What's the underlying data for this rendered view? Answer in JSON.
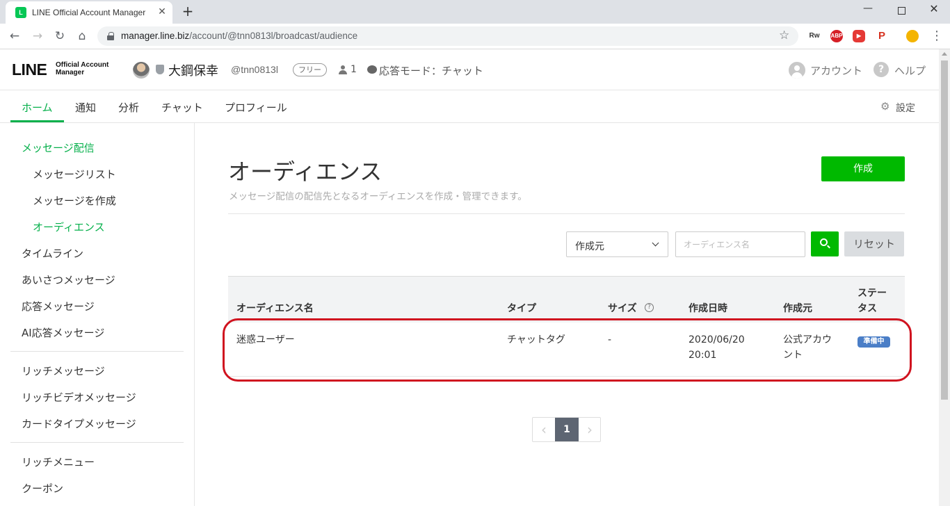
{
  "browser": {
    "tab_title": "LINE Official Account Manager",
    "favicon_letter": "L",
    "url_host": "manager.line.biz",
    "url_path": "/account/@tnn0813l/broadcast/audience",
    "nav_back": "←",
    "nav_forward": "→",
    "nav_reload": "↻",
    "nav_home": "⌂",
    "new_tab": "+",
    "close_tab": "✕",
    "win_min": "—",
    "win_close": "✕",
    "star": "☆",
    "menu": "⋮",
    "extensions": [
      {
        "name": "rw",
        "label": "Rw",
        "color": "#ffffff"
      },
      {
        "name": "abp",
        "label": "ABP",
        "color": "#d61f26"
      },
      {
        "name": "youtube",
        "label": "▶",
        "color": "#e53935"
      },
      {
        "name": "pocket",
        "label": "P",
        "color": "#d6311f"
      },
      {
        "name": "keep",
        "label": "",
        "color": "#f4b400"
      }
    ]
  },
  "header": {
    "logo_main": "LINE",
    "logo_sub1": "Official Account",
    "logo_sub2": "Manager",
    "account_name": "大鋼保幸",
    "account_id": "@tnn0813l",
    "plan": "フリー",
    "friends_count": "1",
    "reply_mode": "応答モード：チャット",
    "account_link": "アカウント",
    "help_icon": "?",
    "help_link": "ヘルプ"
  },
  "nav": {
    "tabs": [
      {
        "label": "ホーム",
        "active": true
      },
      {
        "label": "通知",
        "active": false
      },
      {
        "label": "分析",
        "active": false
      },
      {
        "label": "チャット",
        "active": false
      },
      {
        "label": "プロフィール",
        "active": false
      }
    ],
    "gear": "⚙",
    "settings": "設定"
  },
  "sidebar": {
    "items": [
      {
        "label": "メッセージ配信",
        "level": 0,
        "active": true
      },
      {
        "label": "メッセージリスト",
        "level": 1,
        "active": false
      },
      {
        "label": "メッセージを作成",
        "level": 1,
        "active": false
      },
      {
        "label": "オーディエンス",
        "level": 1,
        "active": true
      },
      {
        "label": "タイムライン",
        "level": 0,
        "active": false
      },
      {
        "label": "あいさつメッセージ",
        "level": 0,
        "active": false
      },
      {
        "label": "応答メッセージ",
        "level": 0,
        "active": false
      },
      {
        "label": "AI応答メッセージ",
        "level": 0,
        "active": false
      },
      {
        "label": "リッチメッセージ",
        "level": 0,
        "active": false
      },
      {
        "label": "リッチビデオメッセージ",
        "level": 0,
        "active": false
      },
      {
        "label": "カードタイプメッセージ",
        "level": 0,
        "active": false
      },
      {
        "label": "リッチメニュー",
        "level": 0,
        "active": false
      },
      {
        "label": "クーポン",
        "level": 0,
        "active": false
      }
    ]
  },
  "main": {
    "title": "オーディエンス",
    "description": "メッセージ配信の配信先となるオーディエンスを作成・管理できます。",
    "create_button": "作成",
    "filter_select_value": "作成元",
    "search_placeholder": "オーディエンス名",
    "reset_button": "リセット",
    "table": {
      "headers": {
        "name": "オーディエンス名",
        "type": "タイプ",
        "size": "サイズ",
        "size_info_icon": "?",
        "created_at": "作成日時",
        "creator": "作成元",
        "status_1": "ステー",
        "status_2": "タス"
      },
      "rows": [
        {
          "name": "迷惑ユーザー",
          "type": "チャットタグ",
          "size": "-",
          "created_date": "2020/06/20",
          "created_time": "20:01",
          "creator_1": "公式アカウ",
          "creator_2": "ント",
          "status": "準備中"
        }
      ]
    },
    "pagination": {
      "prev": "‹",
      "current_page": "1",
      "next": "›"
    }
  },
  "colors": {
    "brand_green": "#06b04b",
    "button_green": "#00b900",
    "status_blue": "#4a7ec7",
    "highlight_red": "#d0131f"
  }
}
